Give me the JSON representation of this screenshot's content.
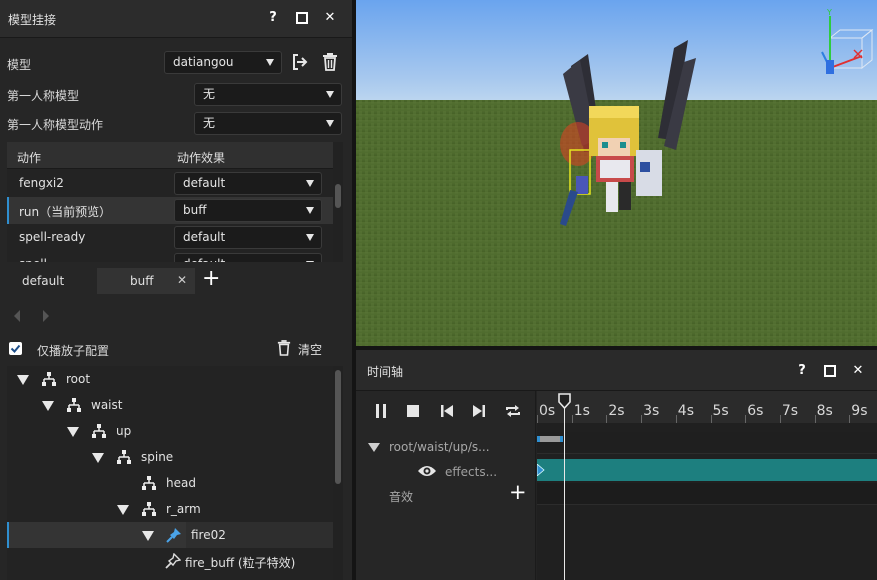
{
  "left_panel": {
    "title": "模型挂接",
    "help": "?",
    "maximize": "□",
    "close": "✕",
    "model_label": "模型",
    "model_value": "datiangou",
    "fp_model_label": "第一人称模型",
    "fp_model_value": "无",
    "fp_anim_label": "第一人称模型动作",
    "fp_anim_value": "无",
    "anim_table": {
      "col_action": "动作",
      "col_effect": "动作效果",
      "rows": [
        {
          "action": "fengxi2",
          "effect": "default"
        },
        {
          "action": "run（当前预览）",
          "effect": "buff"
        },
        {
          "action": "spell-ready",
          "effect": "default"
        },
        {
          "action": "spell",
          "effect": "default"
        }
      ]
    },
    "tabs": {
      "default": "default",
      "buff": "buff",
      "close": "✕",
      "add": "+"
    },
    "only_particles_label": "仅播放子配置",
    "clear_label": "清空",
    "tree": [
      {
        "name": "root",
        "depth": 0,
        "type": "bone"
      },
      {
        "name": "waist",
        "depth": 1,
        "type": "bone"
      },
      {
        "name": "up",
        "depth": 2,
        "type": "bone"
      },
      {
        "name": "spine",
        "depth": 3,
        "type": "bone"
      },
      {
        "name": "head",
        "depth": 4,
        "type": "bone"
      },
      {
        "name": "r_arm",
        "depth": 4,
        "type": "bone"
      },
      {
        "name": "fire02",
        "depth": 5,
        "type": "locator"
      },
      {
        "name": "fire_buff (粒子特效)",
        "depth": 6,
        "type": "particle"
      }
    ]
  },
  "viewport": {
    "gizmo_y": "Y"
  },
  "timeline": {
    "title": "时间轴",
    "help": "?",
    "maximize": "□",
    "close": "✕",
    "ticks": [
      "0s",
      "1s",
      "2s",
      "3s",
      "4s",
      "5s",
      "6s",
      "7s",
      "8s",
      "9s"
    ],
    "track_path": "root/waist/up/s...",
    "effects_label": "effects...",
    "sound_label": "音效",
    "add": "+"
  },
  "colors": {
    "accent": "#2f8fd0",
    "track_clip": "#1d7f7f",
    "sky_top": "#6ea8f0",
    "grass": "#4d6a2e"
  }
}
